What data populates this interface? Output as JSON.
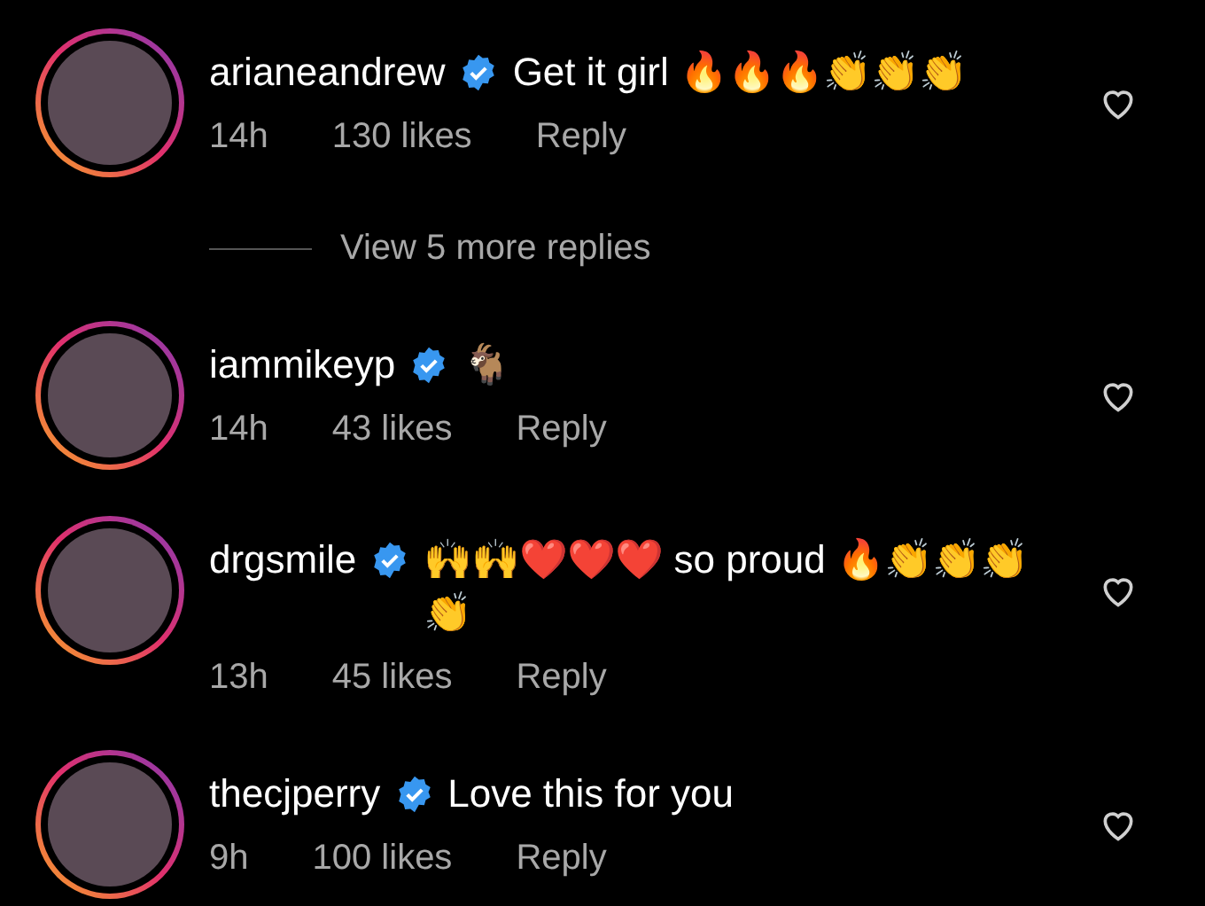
{
  "comments": [
    {
      "username": "arianeandrew",
      "verified": true,
      "text": "Get it girl 🔥🔥🔥👏👏👏",
      "time": "14h",
      "likes": "130 likes",
      "reply": "Reply",
      "more_replies": "View 5 more replies",
      "liked": false
    },
    {
      "username": "iammikeyp",
      "verified": true,
      "text": "🐐",
      "time": "14h",
      "likes": "43 likes",
      "reply": "Reply",
      "liked": false
    },
    {
      "username": "drgsmile",
      "verified": true,
      "text": "🙌🙌❤️❤️❤️ so proud 🔥👏👏👏👏",
      "time": "13h",
      "likes": "45 likes",
      "reply": "Reply",
      "liked": false
    },
    {
      "username": "thecjperry",
      "verified": true,
      "text": "Love this for you",
      "time": "9h",
      "likes": "100 likes",
      "reply": "Reply",
      "liked": false
    }
  ]
}
